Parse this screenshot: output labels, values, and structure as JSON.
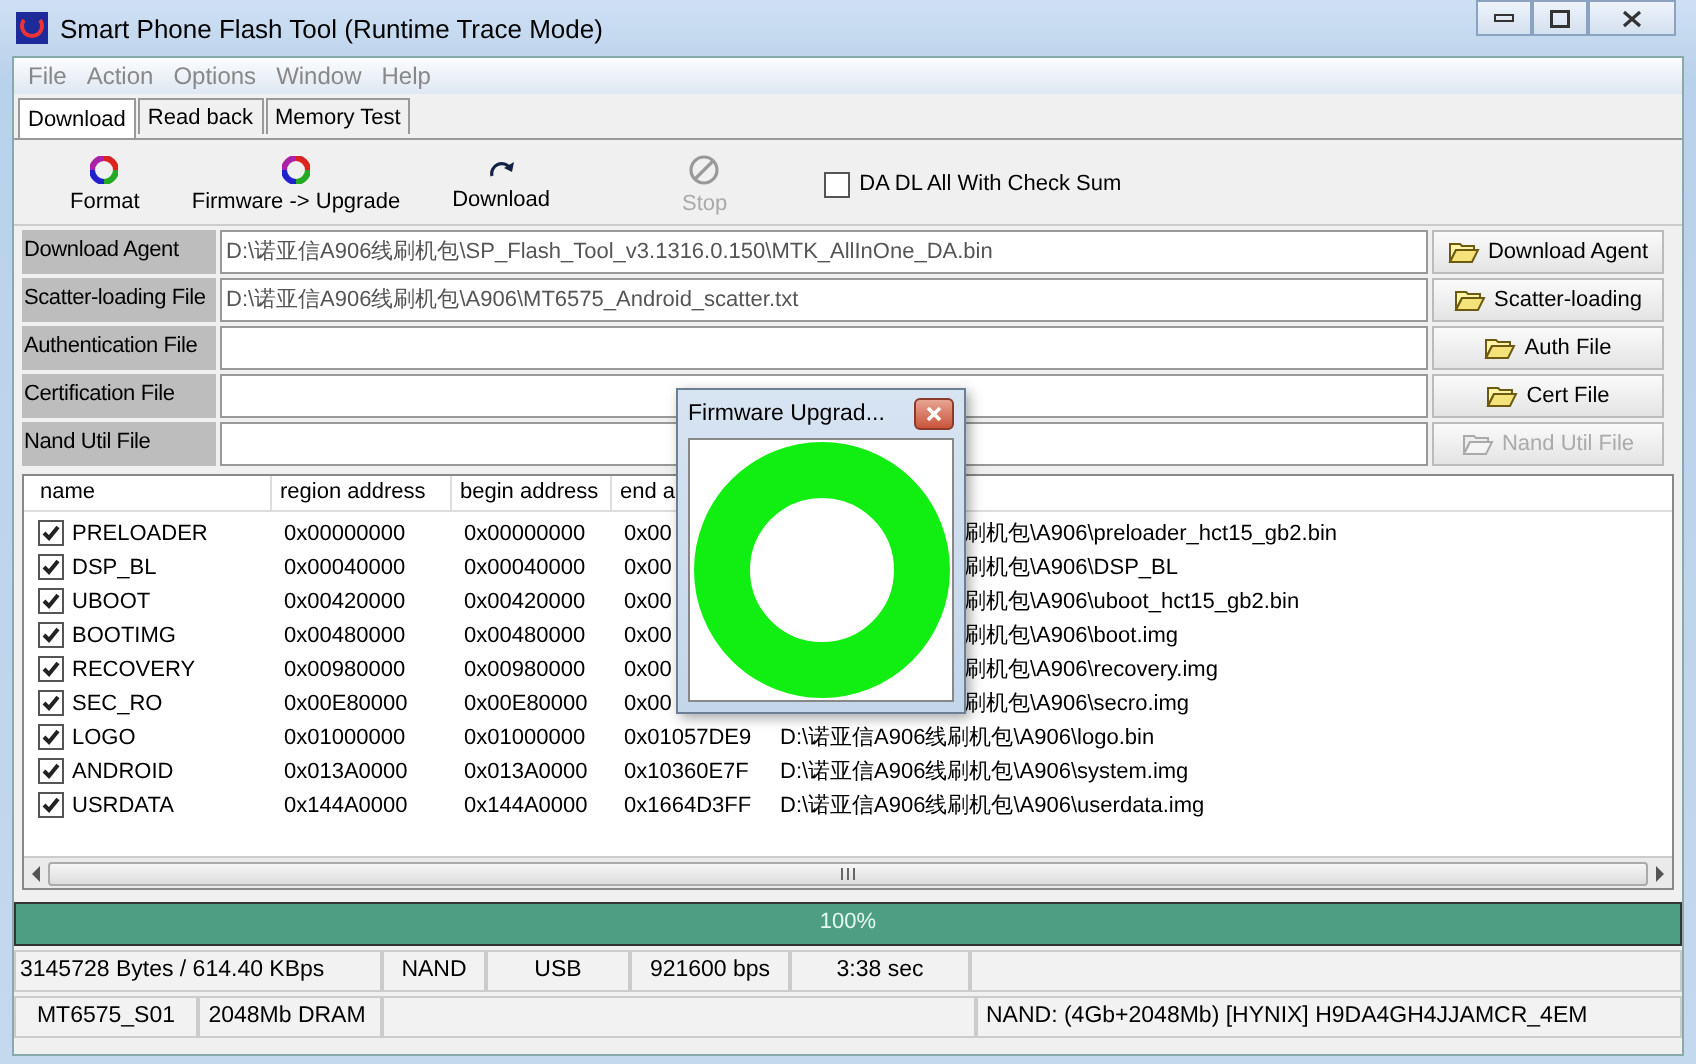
{
  "window": {
    "title": "Smart Phone Flash Tool (Runtime Trace Mode)"
  },
  "menu": [
    "File",
    "Action",
    "Options",
    "Window",
    "Help"
  ],
  "tabs": [
    {
      "label": "Download",
      "selected": true
    },
    {
      "label": "Read back",
      "selected": false
    },
    {
      "label": "Memory Test",
      "selected": false
    }
  ],
  "toolbar": [
    {
      "kind": "format",
      "label": "Format",
      "disabled": false
    },
    {
      "kind": "firmware",
      "label": "Firmware -> Upgrade",
      "disabled": false
    },
    {
      "kind": "download",
      "label": "Download",
      "disabled": false
    },
    {
      "kind": "stop",
      "label": "Stop",
      "disabled": true
    }
  ],
  "checksum": {
    "label": "DA DL All With Check Sum",
    "checked": false
  },
  "files": [
    {
      "label": "Download Agent",
      "value": "D:\\诺亚信A906线刷机包\\SP_Flash_Tool_v3.1316.0.150\\MTK_AllInOne_DA.bin",
      "button": "Download Agent",
      "disabled": false
    },
    {
      "label": "Scatter-loading File",
      "value": "D:\\诺亚信A906线刷机包\\A906\\MT6575_Android_scatter.txt",
      "button": "Scatter-loading",
      "disabled": false
    },
    {
      "label": "Authentication File",
      "button": "Auth File",
      "disabled": false
    },
    {
      "label": "Certification File",
      "button": "Cert File",
      "disabled": false
    },
    {
      "label": "Nand Util File",
      "button": "Nand Util File",
      "disabled": true
    }
  ],
  "table": {
    "columns": [
      "name",
      "region address",
      "begin address",
      "end a"
    ],
    "rows": [
      {
        "name": "PRELOADER",
        "checked": true,
        "region": "0x00000000",
        "begin": "0x00000000",
        "end": "0x00",
        "location": "刷机包\\A906\\preloader_hct15_gb2.bin",
        "covered": true
      },
      {
        "name": "DSP_BL",
        "checked": true,
        "region": "0x00040000",
        "begin": "0x00040000",
        "end": "0x00",
        "location": "刷机包\\A906\\DSP_BL",
        "covered": true
      },
      {
        "name": "UBOOT",
        "checked": true,
        "region": "0x00420000",
        "begin": "0x00420000",
        "end": "0x00",
        "location": "刷机包\\A906\\uboot_hct15_gb2.bin",
        "covered": true
      },
      {
        "name": "BOOTIMG",
        "checked": true,
        "region": "0x00480000",
        "begin": "0x00480000",
        "end": "0x00",
        "location": "刷机包\\A906\\boot.img",
        "covered": true
      },
      {
        "name": "RECOVERY",
        "checked": true,
        "region": "0x00980000",
        "begin": "0x00980000",
        "end": "0x00",
        "location": "刷机包\\A906\\recovery.img",
        "covered": true
      },
      {
        "name": "SEC_RO",
        "checked": true,
        "region": "0x00E80000",
        "begin": "0x00E80000",
        "end": "0x00",
        "location": "刷机包\\A906\\secro.img",
        "covered": true
      },
      {
        "name": "LOGO",
        "checked": true,
        "region": "0x01000000",
        "begin": "0x01000000",
        "end": "0x01057DE9",
        "location": "D:\\诺亚信A906线刷机包\\A906\\logo.bin",
        "covered": false
      },
      {
        "name": "ANDROID",
        "checked": true,
        "region": "0x013A0000",
        "begin": "0x013A0000",
        "end": "0x10360E7F",
        "location": "D:\\诺亚信A906线刷机包\\A906\\system.img",
        "covered": false
      },
      {
        "name": "USRDATA",
        "checked": true,
        "region": "0x144A0000",
        "begin": "0x144A0000",
        "end": "0x1664D3FF",
        "location": "D:\\诺亚信A906线刷机包\\A906\\userdata.img",
        "covered": false
      }
    ]
  },
  "progress": {
    "label": "100%",
    "level": 1
  },
  "status_bar": [
    [
      "3145728 Bytes / 614.40 KBps",
      "NAND",
      "USB",
      "921600 bps",
      "3:38 sec"
    ],
    [
      "MT6575_S01",
      "2048Mb DRAM",
      "NAND: (4Gb+2048Mb) [HYNIX] H9DA4GH4JJAMCR_4EM"
    ]
  ],
  "dialog": {
    "title": "Firmware Upgrad..."
  }
}
